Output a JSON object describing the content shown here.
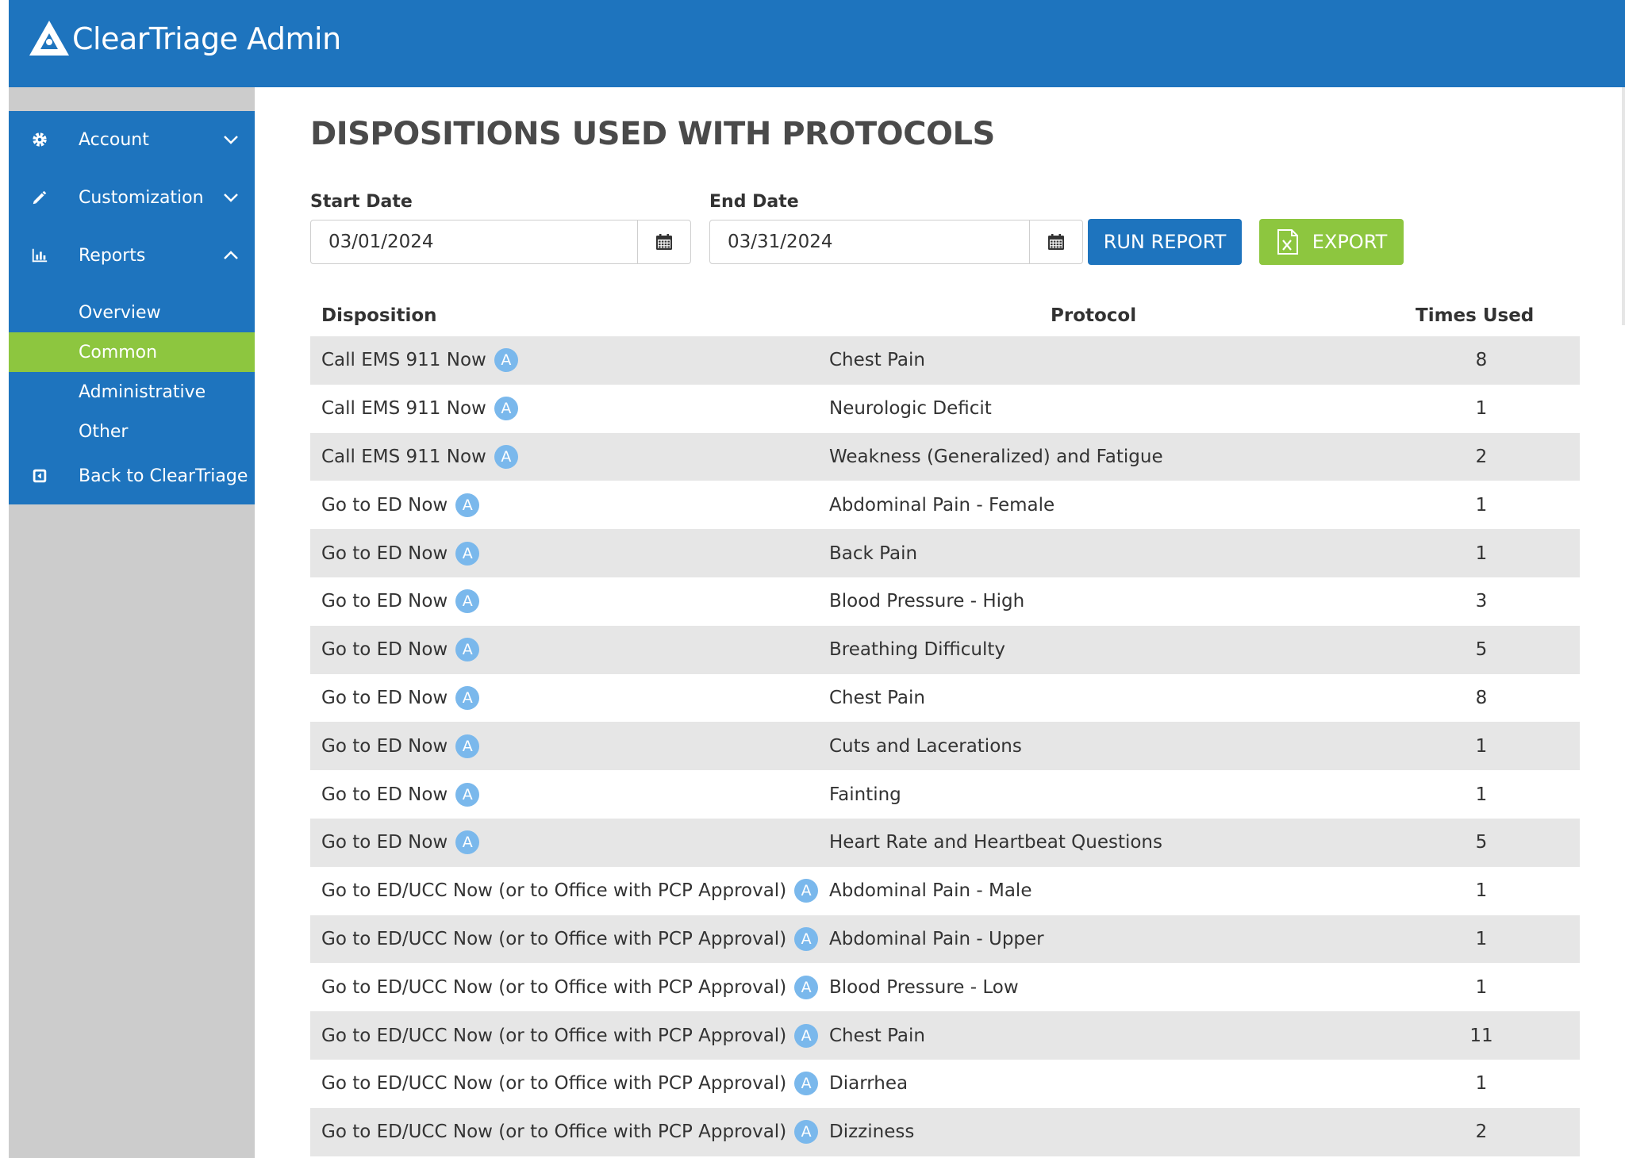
{
  "app": {
    "title": "ClearTriage Admin"
  },
  "sidebar": {
    "items": [
      {
        "label": "Account",
        "icon": "gear-icon",
        "expanded": false
      },
      {
        "label": "Customization",
        "icon": "pencil-icon",
        "expanded": false
      },
      {
        "label": "Reports",
        "icon": "bar-chart-icon",
        "expanded": true
      }
    ],
    "sub_items": [
      {
        "label": "Overview",
        "active": false
      },
      {
        "label": "Common",
        "active": true
      },
      {
        "label": "Administrative",
        "active": false
      },
      {
        "label": "Other",
        "active": false
      }
    ],
    "back": {
      "label": "Back to ClearTriage",
      "icon": "back-icon"
    }
  },
  "main": {
    "title": "DISPOSITIONS USED WITH PROTOCOLS",
    "start_date": {
      "label": "Start Date",
      "value": "03/01/2024"
    },
    "end_date": {
      "label": "End Date",
      "value": "03/31/2024"
    },
    "run_button": "RUN REPORT",
    "export_button": "EXPORT"
  },
  "table": {
    "columns": [
      "Disposition",
      "Protocol",
      "Times Used"
    ],
    "badge_label": "A",
    "rows": [
      {
        "disposition": "Call EMS 911 Now",
        "protocol": "Chest Pain",
        "times": "8"
      },
      {
        "disposition": "Call EMS 911 Now",
        "protocol": "Neurologic Deficit",
        "times": "1"
      },
      {
        "disposition": "Call EMS 911 Now",
        "protocol": "Weakness (Generalized) and Fatigue",
        "times": "2"
      },
      {
        "disposition": "Go to ED Now",
        "protocol": "Abdominal Pain - Female",
        "times": "1"
      },
      {
        "disposition": "Go to ED Now",
        "protocol": "Back Pain",
        "times": "1"
      },
      {
        "disposition": "Go to ED Now",
        "protocol": "Blood Pressure - High",
        "times": "3"
      },
      {
        "disposition": "Go to ED Now",
        "protocol": "Breathing Difficulty",
        "times": "5"
      },
      {
        "disposition": "Go to ED Now",
        "protocol": "Chest Pain",
        "times": "8"
      },
      {
        "disposition": "Go to ED Now",
        "protocol": "Cuts and Lacerations",
        "times": "1"
      },
      {
        "disposition": "Go to ED Now",
        "protocol": "Fainting",
        "times": "1"
      },
      {
        "disposition": "Go to ED Now",
        "protocol": "Heart Rate and Heartbeat Questions",
        "times": "5"
      },
      {
        "disposition": "Go to ED/UCC Now (or to Office with PCP Approval)",
        "protocol": "Abdominal Pain - Male",
        "times": "1"
      },
      {
        "disposition": "Go to ED/UCC Now (or to Office with PCP Approval)",
        "protocol": "Abdominal Pain - Upper",
        "times": "1"
      },
      {
        "disposition": "Go to ED/UCC Now (or to Office with PCP Approval)",
        "protocol": "Blood Pressure - Low",
        "times": "1"
      },
      {
        "disposition": "Go to ED/UCC Now (or to Office with PCP Approval)",
        "protocol": "Chest Pain",
        "times": "11"
      },
      {
        "disposition": "Go to ED/UCC Now (or to Office with PCP Approval)",
        "protocol": "Diarrhea",
        "times": "1"
      },
      {
        "disposition": "Go to ED/UCC Now (or to Office with PCP Approval)",
        "protocol": "Dizziness",
        "times": "2"
      }
    ]
  },
  "colors": {
    "brand_blue": "#1e74be",
    "accent_green": "#8dc63f",
    "badge_blue": "#7ab8ec",
    "row_shade": "#e6e6e6",
    "sidebar_gray": "#cccccc"
  }
}
